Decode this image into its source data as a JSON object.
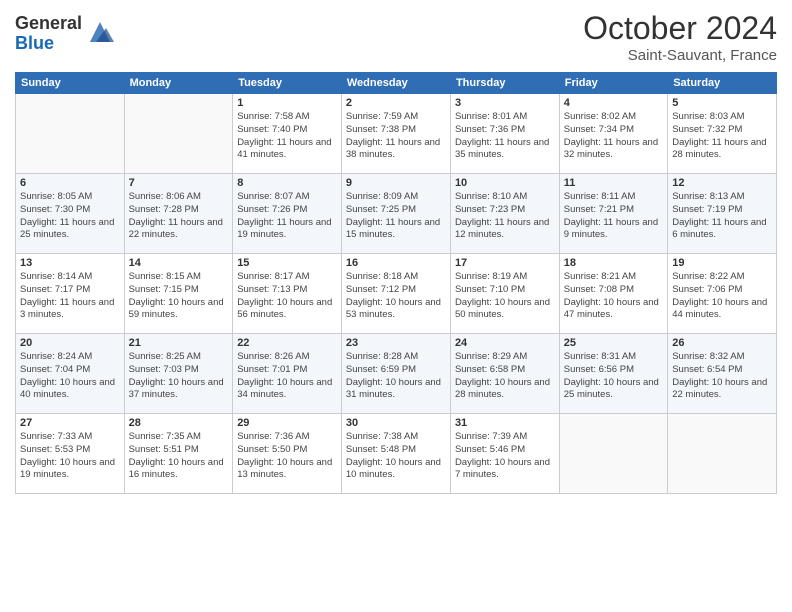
{
  "logo": {
    "general": "General",
    "blue": "Blue"
  },
  "header": {
    "month": "October 2024",
    "location": "Saint-Sauvant, France"
  },
  "days_of_week": [
    "Sunday",
    "Monday",
    "Tuesday",
    "Wednesday",
    "Thursday",
    "Friday",
    "Saturday"
  ],
  "weeks": [
    [
      {
        "day": "",
        "sunrise": "",
        "sunset": "",
        "daylight": ""
      },
      {
        "day": "",
        "sunrise": "",
        "sunset": "",
        "daylight": ""
      },
      {
        "day": "1",
        "sunrise": "Sunrise: 7:58 AM",
        "sunset": "Sunset: 7:40 PM",
        "daylight": "Daylight: 11 hours and 41 minutes."
      },
      {
        "day": "2",
        "sunrise": "Sunrise: 7:59 AM",
        "sunset": "Sunset: 7:38 PM",
        "daylight": "Daylight: 11 hours and 38 minutes."
      },
      {
        "day": "3",
        "sunrise": "Sunrise: 8:01 AM",
        "sunset": "Sunset: 7:36 PM",
        "daylight": "Daylight: 11 hours and 35 minutes."
      },
      {
        "day": "4",
        "sunrise": "Sunrise: 8:02 AM",
        "sunset": "Sunset: 7:34 PM",
        "daylight": "Daylight: 11 hours and 32 minutes."
      },
      {
        "day": "5",
        "sunrise": "Sunrise: 8:03 AM",
        "sunset": "Sunset: 7:32 PM",
        "daylight": "Daylight: 11 hours and 28 minutes."
      }
    ],
    [
      {
        "day": "6",
        "sunrise": "Sunrise: 8:05 AM",
        "sunset": "Sunset: 7:30 PM",
        "daylight": "Daylight: 11 hours and 25 minutes."
      },
      {
        "day": "7",
        "sunrise": "Sunrise: 8:06 AM",
        "sunset": "Sunset: 7:28 PM",
        "daylight": "Daylight: 11 hours and 22 minutes."
      },
      {
        "day": "8",
        "sunrise": "Sunrise: 8:07 AM",
        "sunset": "Sunset: 7:26 PM",
        "daylight": "Daylight: 11 hours and 19 minutes."
      },
      {
        "day": "9",
        "sunrise": "Sunrise: 8:09 AM",
        "sunset": "Sunset: 7:25 PM",
        "daylight": "Daylight: 11 hours and 15 minutes."
      },
      {
        "day": "10",
        "sunrise": "Sunrise: 8:10 AM",
        "sunset": "Sunset: 7:23 PM",
        "daylight": "Daylight: 11 hours and 12 minutes."
      },
      {
        "day": "11",
        "sunrise": "Sunrise: 8:11 AM",
        "sunset": "Sunset: 7:21 PM",
        "daylight": "Daylight: 11 hours and 9 minutes."
      },
      {
        "day": "12",
        "sunrise": "Sunrise: 8:13 AM",
        "sunset": "Sunset: 7:19 PM",
        "daylight": "Daylight: 11 hours and 6 minutes."
      }
    ],
    [
      {
        "day": "13",
        "sunrise": "Sunrise: 8:14 AM",
        "sunset": "Sunset: 7:17 PM",
        "daylight": "Daylight: 11 hours and 3 minutes."
      },
      {
        "day": "14",
        "sunrise": "Sunrise: 8:15 AM",
        "sunset": "Sunset: 7:15 PM",
        "daylight": "Daylight: 10 hours and 59 minutes."
      },
      {
        "day": "15",
        "sunrise": "Sunrise: 8:17 AM",
        "sunset": "Sunset: 7:13 PM",
        "daylight": "Daylight: 10 hours and 56 minutes."
      },
      {
        "day": "16",
        "sunrise": "Sunrise: 8:18 AM",
        "sunset": "Sunset: 7:12 PM",
        "daylight": "Daylight: 10 hours and 53 minutes."
      },
      {
        "day": "17",
        "sunrise": "Sunrise: 8:19 AM",
        "sunset": "Sunset: 7:10 PM",
        "daylight": "Daylight: 10 hours and 50 minutes."
      },
      {
        "day": "18",
        "sunrise": "Sunrise: 8:21 AM",
        "sunset": "Sunset: 7:08 PM",
        "daylight": "Daylight: 10 hours and 47 minutes."
      },
      {
        "day": "19",
        "sunrise": "Sunrise: 8:22 AM",
        "sunset": "Sunset: 7:06 PM",
        "daylight": "Daylight: 10 hours and 44 minutes."
      }
    ],
    [
      {
        "day": "20",
        "sunrise": "Sunrise: 8:24 AM",
        "sunset": "Sunset: 7:04 PM",
        "daylight": "Daylight: 10 hours and 40 minutes."
      },
      {
        "day": "21",
        "sunrise": "Sunrise: 8:25 AM",
        "sunset": "Sunset: 7:03 PM",
        "daylight": "Daylight: 10 hours and 37 minutes."
      },
      {
        "day": "22",
        "sunrise": "Sunrise: 8:26 AM",
        "sunset": "Sunset: 7:01 PM",
        "daylight": "Daylight: 10 hours and 34 minutes."
      },
      {
        "day": "23",
        "sunrise": "Sunrise: 8:28 AM",
        "sunset": "Sunset: 6:59 PM",
        "daylight": "Daylight: 10 hours and 31 minutes."
      },
      {
        "day": "24",
        "sunrise": "Sunrise: 8:29 AM",
        "sunset": "Sunset: 6:58 PM",
        "daylight": "Daylight: 10 hours and 28 minutes."
      },
      {
        "day": "25",
        "sunrise": "Sunrise: 8:31 AM",
        "sunset": "Sunset: 6:56 PM",
        "daylight": "Daylight: 10 hours and 25 minutes."
      },
      {
        "day": "26",
        "sunrise": "Sunrise: 8:32 AM",
        "sunset": "Sunset: 6:54 PM",
        "daylight": "Daylight: 10 hours and 22 minutes."
      }
    ],
    [
      {
        "day": "27",
        "sunrise": "Sunrise: 7:33 AM",
        "sunset": "Sunset: 5:53 PM",
        "daylight": "Daylight: 10 hours and 19 minutes."
      },
      {
        "day": "28",
        "sunrise": "Sunrise: 7:35 AM",
        "sunset": "Sunset: 5:51 PM",
        "daylight": "Daylight: 10 hours and 16 minutes."
      },
      {
        "day": "29",
        "sunrise": "Sunrise: 7:36 AM",
        "sunset": "Sunset: 5:50 PM",
        "daylight": "Daylight: 10 hours and 13 minutes."
      },
      {
        "day": "30",
        "sunrise": "Sunrise: 7:38 AM",
        "sunset": "Sunset: 5:48 PM",
        "daylight": "Daylight: 10 hours and 10 minutes."
      },
      {
        "day": "31",
        "sunrise": "Sunrise: 7:39 AM",
        "sunset": "Sunset: 5:46 PM",
        "daylight": "Daylight: 10 hours and 7 minutes."
      },
      {
        "day": "",
        "sunrise": "",
        "sunset": "",
        "daylight": ""
      },
      {
        "day": "",
        "sunrise": "",
        "sunset": "",
        "daylight": ""
      }
    ]
  ]
}
